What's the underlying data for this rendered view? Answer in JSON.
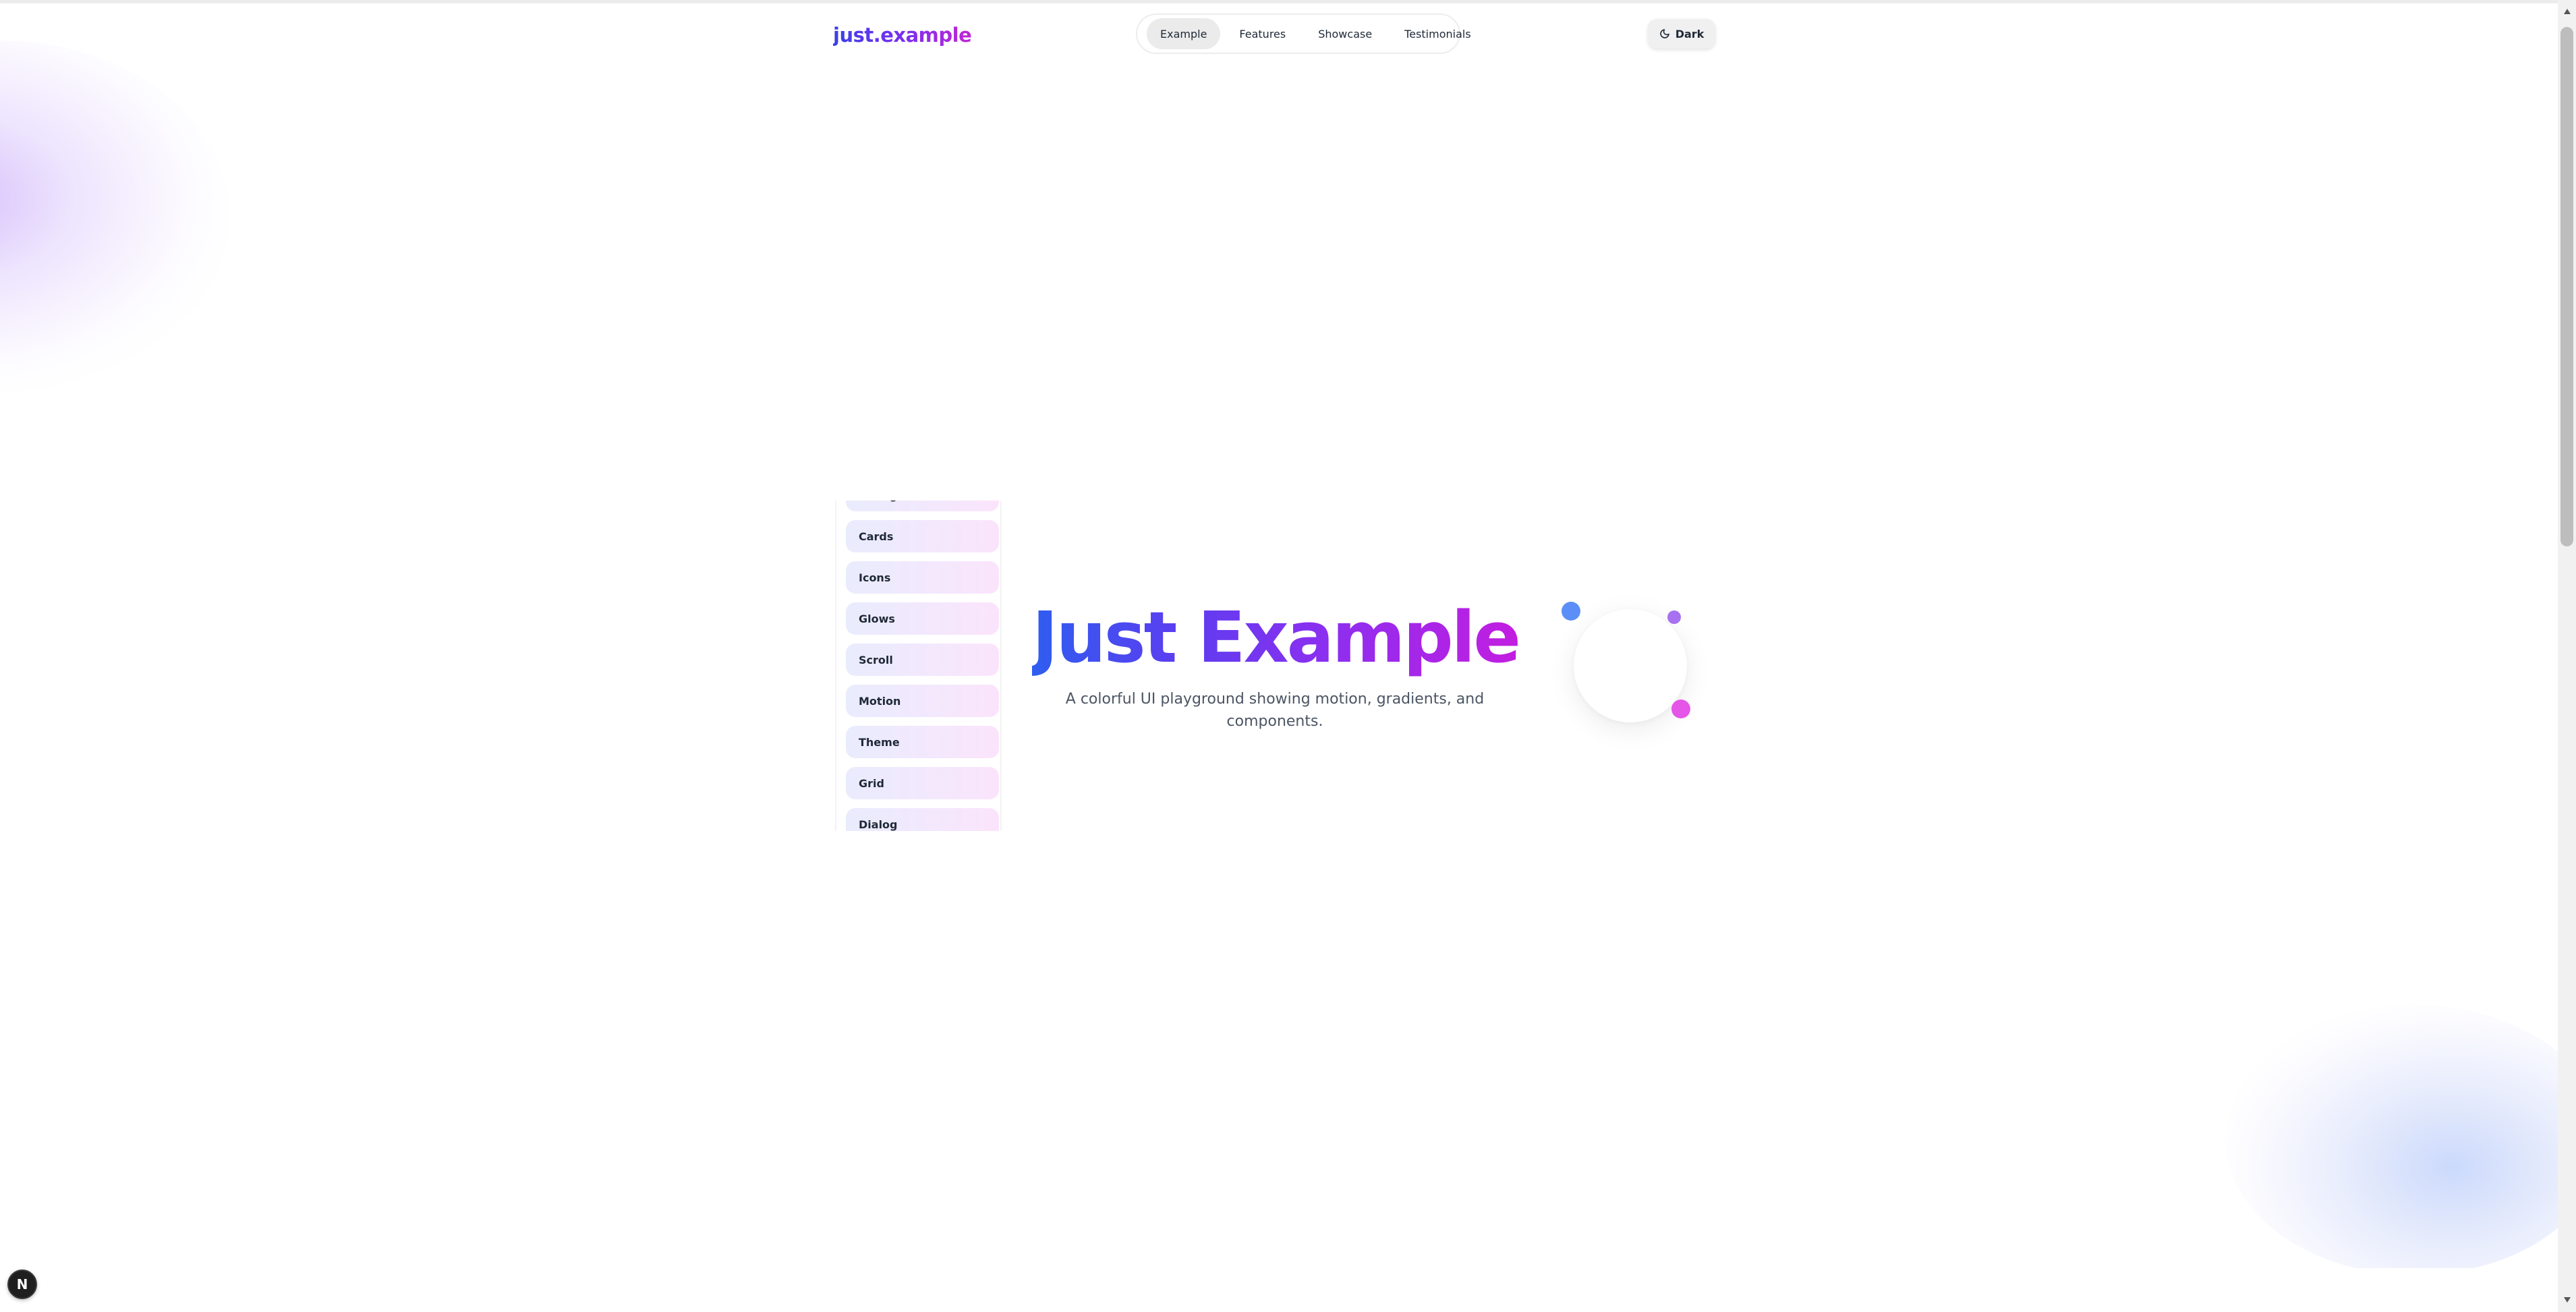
{
  "header": {
    "logo": "just.example",
    "nav": [
      {
        "label": "Example",
        "active": true
      },
      {
        "label": "Features",
        "active": false
      },
      {
        "label": "Showcase",
        "active": false
      },
      {
        "label": "Testimonials",
        "active": false
      }
    ],
    "theme_toggle": {
      "label": "Dark",
      "icon": "moon-icon"
    }
  },
  "sidebar": {
    "items": [
      {
        "label": "Dialog"
      },
      {
        "label": "Cards"
      },
      {
        "label": "Icons"
      },
      {
        "label": "Glows"
      },
      {
        "label": "Scroll"
      },
      {
        "label": "Motion"
      },
      {
        "label": "Theme"
      },
      {
        "label": "Grid"
      },
      {
        "label": "Dialog"
      }
    ]
  },
  "hero": {
    "title": "Just Example",
    "subtitle": "A colorful UI playground showing motion, gradients, and components."
  },
  "badge": {
    "label": "N"
  },
  "colors": {
    "gradient_start": "#2f5df0",
    "gradient_mid": "#8b2ff0",
    "gradient_end": "#c21ee0",
    "dot_blue": "#5b8ff7",
    "dot_violet": "#a771f0",
    "dot_pink": "#e455e8"
  }
}
